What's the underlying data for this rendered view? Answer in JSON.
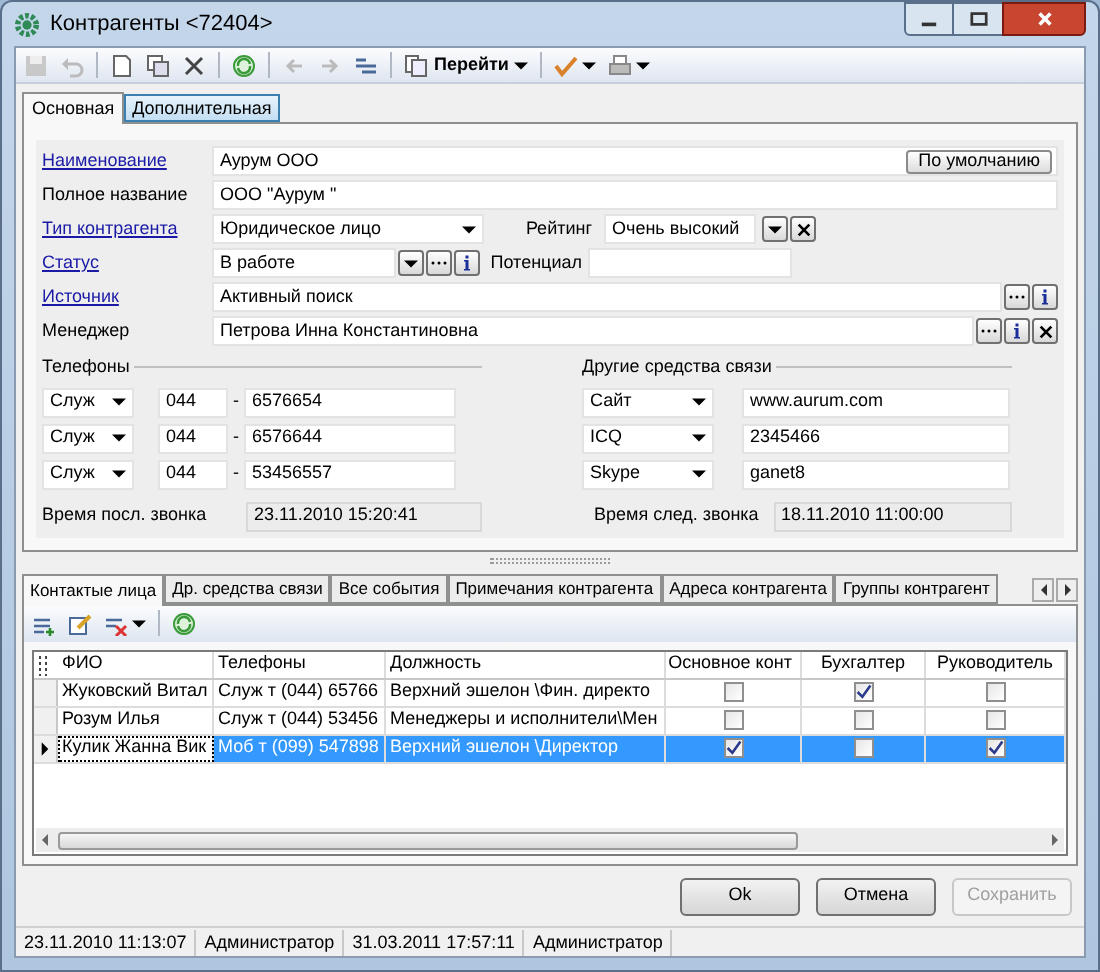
{
  "window": {
    "title": "Контрагенты <72404>"
  },
  "toolbar": {
    "goto_label": "Перейти"
  },
  "tabs": [
    {
      "label": "Основная",
      "selected": true
    },
    {
      "label": "Дополнительная",
      "selected": false
    }
  ],
  "form": {
    "name": {
      "label": "Наименование",
      "value": "Аурум ООО",
      "button": "По умолчанию"
    },
    "full_name": {
      "label": "Полное название",
      "value": "ООО \"Аурум \""
    },
    "type": {
      "label": "Тип контрагента",
      "value": "Юридическое лицо"
    },
    "rating": {
      "label": "Рейтинг",
      "value": "Очень высокий"
    },
    "status": {
      "label": "Статус",
      "value": "В работе"
    },
    "potential": {
      "label": "Потенциал"
    },
    "source": {
      "label": "Источник",
      "value": "Активный поиск"
    },
    "manager": {
      "label": "Менеджер",
      "value": "Петрова Инна Константиновна"
    }
  },
  "phones": {
    "title": "Телефоны",
    "rows": [
      {
        "type": "Служ",
        "code": "044",
        "dash": "-",
        "number": "6576654"
      },
      {
        "type": "Служ",
        "code": "044",
        "dash": "-",
        "number": "6576644"
      },
      {
        "type": "Служ",
        "code": "044",
        "dash": "-",
        "number": "53456557"
      }
    ],
    "last_call_label": "Время посл. звонка",
    "last_call": "23.11.2010 15:20:41"
  },
  "other": {
    "title": "Другие средства связи",
    "rows": [
      {
        "type": "Сайт",
        "value": "www.aurum.com"
      },
      {
        "type": "ICQ",
        "value": "2345466"
      },
      {
        "type": "Skype",
        "value": "ganet8"
      }
    ],
    "next_call_label": "Время след. звонка",
    "next_call": "18.11.2010 11:00:00"
  },
  "lower_tabs": [
    {
      "label": "Контактые лица",
      "selected": true
    },
    {
      "label": "Др. средства связи",
      "selected": false
    },
    {
      "label": "Все события",
      "selected": false
    },
    {
      "label": "Примечания контрагента",
      "selected": false
    },
    {
      "label": "Адреса контрагента",
      "selected": false
    },
    {
      "label": "Группы контрагент",
      "selected": false
    }
  ],
  "grid": {
    "columns": [
      "ФИО",
      "Телефоны",
      "Должность",
      "Основное конт",
      "Бухгалтер",
      "Руководитель"
    ],
    "rows": [
      {
        "name": "Жуковский Витал",
        "phone": "Служ т (044) 65766",
        "position": "Верхний эшелон \\Фин. директо",
        "main": false,
        "accountant": true,
        "head": false,
        "selected": false
      },
      {
        "name": "Розум Илья",
        "phone": "Служ т (044) 53456",
        "position": "Менеджеры и исполнители\\Мен",
        "main": false,
        "accountant": false,
        "head": false,
        "selected": false
      },
      {
        "name": "Кулик  Жанна Вик",
        "phone": "Моб т (099) 547898",
        "position": "Верхний эшелон \\Директор",
        "main": true,
        "accountant": false,
        "head": true,
        "selected": true
      }
    ]
  },
  "buttons": [
    {
      "label": "Ok",
      "disabled": false
    },
    {
      "label": "Отмена",
      "disabled": false
    },
    {
      "label": "Сохранить",
      "disabled": true
    }
  ],
  "status_bar": [
    "23.11.2010 11:13:07",
    "Администратор",
    "31.03.2011 17:57:11",
    "Администратор"
  ]
}
